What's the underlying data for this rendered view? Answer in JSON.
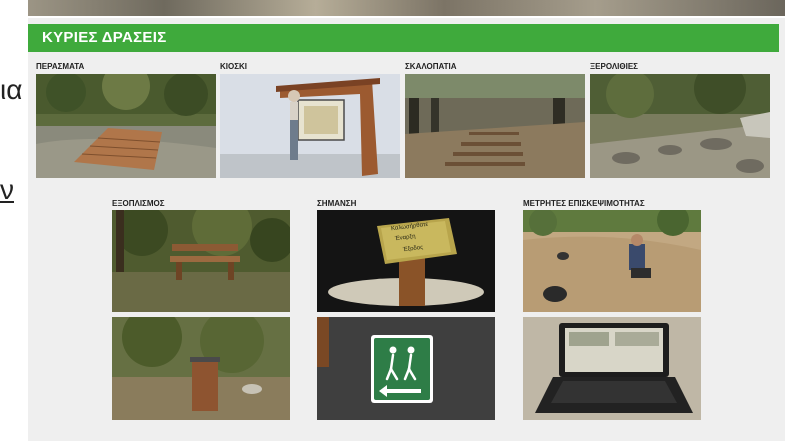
{
  "slide": {
    "title": "ΚΥΡΙΕΣ ΔΡΑΣΕΙΣ",
    "accent_color": "#3faa3c"
  },
  "edge_text": {
    "fragment_1": "ια",
    "fragment_2": "ν"
  },
  "sections": {
    "perasmata": "ΠΕΡΑΣΜΑΤΑ",
    "kioski": "ΚΙΟΣΚΙ",
    "skalopatia": "ΣΚΑΛΟΠΑΤΙΑ",
    "xerolithies": "ΞΕΡΟΛΙΘΙΕΣ",
    "exoplismos": "ΕΞΟΠΛΙΣΜΟΣ",
    "simansi": "ΣΗΜΑΝΣΗ",
    "metrites": "ΜΕΤΡΗΤΕΣ ΕΠΙΣΚΕΨΙΜΟΤΗΤΑΣ"
  },
  "sign_text": {
    "line_1": "Καλωσήρθατε",
    "line_2": "Έναρξη",
    "line_3": "Έξοδος"
  }
}
